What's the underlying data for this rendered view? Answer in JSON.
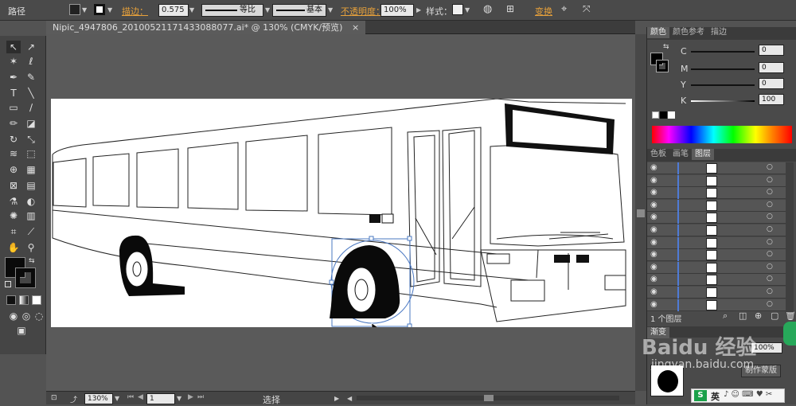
{
  "control_bar": {
    "selection_type": "路径",
    "stroke_label": "描边：",
    "stroke_width": "0.575",
    "stroke_profile": "等比",
    "brush": "基本",
    "opacity_label": "不透明度：",
    "opacity_value": "100%",
    "style_label": "样式：",
    "transform_label": "变换"
  },
  "document": {
    "tab_title": "Nipic_4947806_20100521171433088077.ai* @ 130% (CMYK/预览)",
    "close": "×"
  },
  "color_panel": {
    "tabs": [
      "颜色",
      "颜色参考",
      "描边"
    ],
    "channels": [
      {
        "name": "C",
        "value": "0"
      },
      {
        "name": "M",
        "value": "0"
      },
      {
        "name": "Y",
        "value": "0"
      },
      {
        "name": "K",
        "value": "100"
      }
    ]
  },
  "layers_panel": {
    "tabs": [
      "色板",
      "画笔",
      "图层"
    ],
    "row_count": 12,
    "footer": "1 个图层"
  },
  "bottom_panel": {
    "tab": "渐变",
    "opacity_value": "100%",
    "button": "制作蒙版"
  },
  "status_bar": {
    "zoom": "130%",
    "page": "1",
    "tool": "选择"
  },
  "watermark": {
    "text": "Baidu 经验",
    "url": "jingyan.baidu.com"
  },
  "ime": {
    "label": "英"
  }
}
